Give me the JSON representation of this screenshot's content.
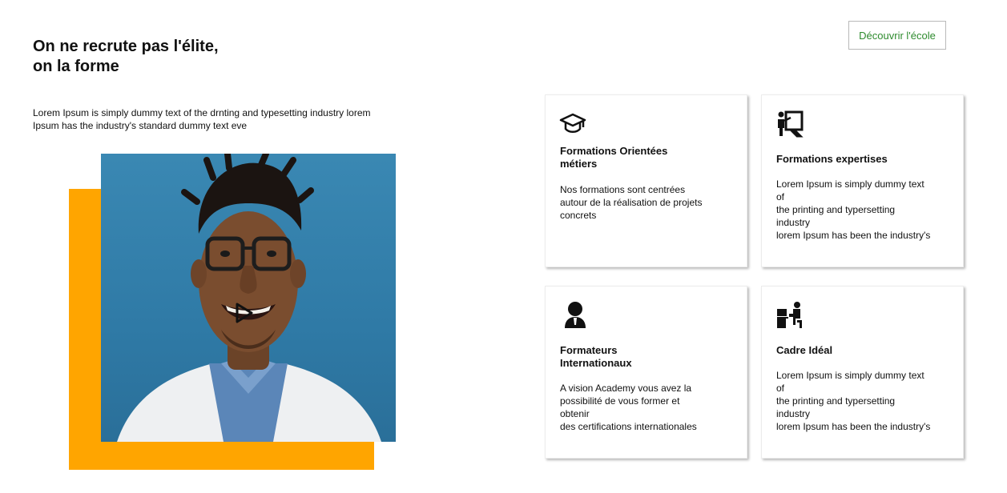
{
  "header": {
    "headline_line1": "On ne recrute pas l'élite,",
    "headline_line2": "on la forme",
    "cta_label": "Découvrir l'école"
  },
  "intro": {
    "line1": "Lorem Ipsum is simply dummy text of the drnting and typesetting industry lorem",
    "line2": "Ipsum has the industry's standard dummy text eve"
  },
  "media": {
    "photo_icon": "portrait-photo",
    "play_icon": "play-icon",
    "accent_color": "#ffa500"
  },
  "cards": [
    {
      "icon": "graduation-cap-icon",
      "title_lines": [
        "Formations Orientées",
        "métiers"
      ],
      "text_lines": [
        "Nos formations sont centrées",
        "autour de la réalisation de projets",
        "concrets"
      ]
    },
    {
      "icon": "teacher-board-icon",
      "title_lines": [
        "Formations expertises"
      ],
      "text_lines": [
        "Lorem Ipsum is simply dummy text",
        "of",
        "the printing and typersetting",
        "industry",
        "lorem Ipsum has been the industry's"
      ]
    },
    {
      "icon": "person-icon",
      "title_lines": [
        "Formateurs",
        "Internationaux"
      ],
      "text_lines": [
        "A vision Academy vous avez la",
        "possibilité de vous former et",
        "obtenir",
        "des certifications internationales"
      ]
    },
    {
      "icon": "desk-worker-icon",
      "title_lines": [
        "Cadre Idéal"
      ],
      "text_lines": [
        "Lorem Ipsum is simply dummy text",
        "of",
        "the printing and typersetting",
        "industry",
        "lorem Ipsum has been the industry's"
      ]
    }
  ]
}
